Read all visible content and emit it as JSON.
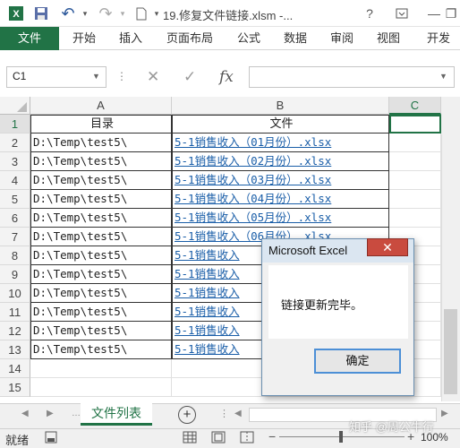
{
  "titlebar": {
    "title": "19.修复文件链接.xlsm -...",
    "save_icon": "save-icon",
    "undo_icon": "undo-icon",
    "redo_icon": "redo-icon",
    "help": "?",
    "minimize": "—",
    "restore": "❐"
  },
  "ribbon": {
    "tabs": [
      "文件",
      "开始",
      "插入",
      "页面布局",
      "公式",
      "数据",
      "审阅",
      "视图",
      "开发"
    ]
  },
  "formula_bar": {
    "name_box": "C1",
    "cancel": "✕",
    "enter": "✓",
    "fx": "fx",
    "value": ""
  },
  "grid": {
    "columns": [
      "A",
      "B",
      "C"
    ],
    "rows": [
      "1",
      "2",
      "3",
      "4",
      "5",
      "6",
      "7",
      "8",
      "9",
      "10",
      "11",
      "12",
      "13",
      "14",
      "15"
    ],
    "header": {
      "a": "目录",
      "b": "文件"
    },
    "data": [
      {
        "a": "D:\\Temp\\test5\\",
        "b": "5-1销售收入（01月份）.xlsx"
      },
      {
        "a": "D:\\Temp\\test5\\",
        "b": "5-1销售收入（02月份）.xlsx"
      },
      {
        "a": "D:\\Temp\\test5\\",
        "b": "5-1销售收入（03月份）.xlsx"
      },
      {
        "a": "D:\\Temp\\test5\\",
        "b": "5-1销售收入（04月份）.xlsx"
      },
      {
        "a": "D:\\Temp\\test5\\",
        "b": "5-1销售收入（05月份）.xlsx"
      },
      {
        "a": "D:\\Temp\\test5\\",
        "b": "5-1销售收入（06月份）.xlsx"
      },
      {
        "a": "D:\\Temp\\test5\\",
        "b": "5-1销售收入"
      },
      {
        "a": "D:\\Temp\\test5\\",
        "b": "5-1销售收入"
      },
      {
        "a": "D:\\Temp\\test5\\",
        "b": "5-1销售收入"
      },
      {
        "a": "D:\\Temp\\test5\\",
        "b": "5-1销售收入"
      },
      {
        "a": "D:\\Temp\\test5\\",
        "b": "5-1销售收入"
      },
      {
        "a": "D:\\Temp\\test5\\",
        "b": "5-1销售收入"
      }
    ]
  },
  "sheets": {
    "active": "文件列表",
    "add": "+"
  },
  "status": {
    "ready": "就绪",
    "zoom": "100%",
    "watermark": "知乎 @周公牛行"
  },
  "dialog": {
    "title": "Microsoft Excel",
    "close": "✕",
    "message": "链接更新完毕。",
    "ok": "确定"
  },
  "colors": {
    "excel_green": "#217346",
    "link": "#1a5ea8",
    "close_red": "#c94b3f"
  }
}
